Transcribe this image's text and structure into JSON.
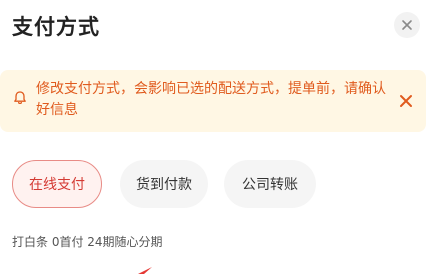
{
  "header": {
    "title": "支付方式",
    "close_icon": "close-icon"
  },
  "notice": {
    "text": "修改支付方式，会影响已选的配送方式，提单前，请确认好信息",
    "icon": "bell-icon",
    "close_icon": "close-icon",
    "color": "#e05b1e",
    "background": "#fff7e4"
  },
  "payment_methods": [
    {
      "label": "在线支付",
      "selected": true
    },
    {
      "label": "货到付款",
      "selected": false
    },
    {
      "label": "公司转账",
      "selected": false
    }
  ],
  "installment_text": "打白条 0首付 24期随心分期",
  "colors": {
    "selected_border": "#e88b86",
    "selected_text": "#d43a33",
    "title": "#222222"
  }
}
